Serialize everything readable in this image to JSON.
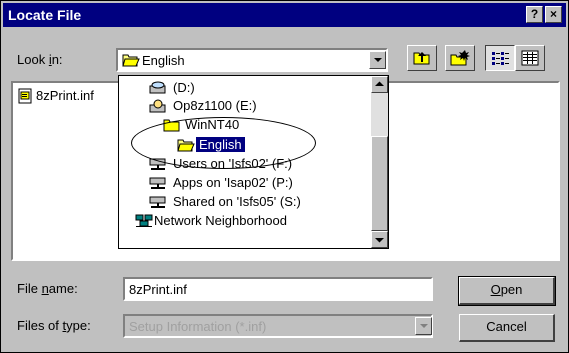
{
  "window": {
    "title": "Locate File",
    "help_button": "?",
    "close_button": "×"
  },
  "look_in": {
    "label_prefix": "Look ",
    "label_access": "i",
    "label_suffix": "n:",
    "value": "English"
  },
  "file_list": {
    "items": [
      {
        "name": "8zPrint.inf",
        "icon": "inf-file-icon"
      }
    ]
  },
  "dropdown": {
    "items": [
      {
        "label": "(D:)",
        "icon": "cd-drive-icon"
      },
      {
        "label": "Op8z1100 (E:)",
        "icon": "cd-drive-icon"
      },
      {
        "label": "WinNT40",
        "icon": "folder-icon"
      },
      {
        "label": "English",
        "icon": "open-folder-icon",
        "selected": true
      },
      {
        "label": "Users on 'Isfs02' (F:)",
        "icon": "network-drive-icon"
      },
      {
        "label": "Apps on 'Isap02' (P:)",
        "icon": "network-drive-icon"
      },
      {
        "label": "Shared on 'Isfs05' (S:)",
        "icon": "network-drive-icon"
      },
      {
        "label": "Network Neighborhood",
        "icon": "network-neighborhood-icon"
      }
    ]
  },
  "file_name": {
    "label_prefix": "File ",
    "label_access": "n",
    "label_suffix": "ame:",
    "value": "8zPrint.inf"
  },
  "file_type": {
    "label_prefix": "Files of ",
    "label_access": "t",
    "label_suffix": "ype:",
    "value": "Setup Information (*.inf)"
  },
  "buttons": {
    "open_access": "O",
    "open_rest": "pen",
    "cancel": "Cancel"
  }
}
